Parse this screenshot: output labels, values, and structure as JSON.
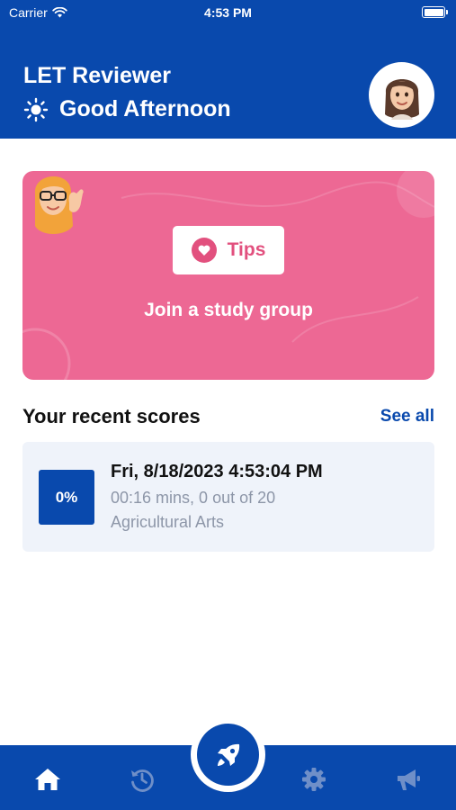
{
  "status_bar": {
    "carrier": "Carrier",
    "time": "4:53 PM"
  },
  "header": {
    "title": "LET Reviewer",
    "greeting": "Good Afternoon",
    "greeting_icon": "sun-icon"
  },
  "tips": {
    "label": "Tips",
    "message": "Join a study group",
    "icon": "heart-icon"
  },
  "recent_scores": {
    "title": "Your recent scores",
    "see_all": "See all",
    "items": [
      {
        "score": "0%",
        "date": "Fri, 8/18/2023 4:53:04 PM",
        "stats": "00:16 mins, 0 out of 20",
        "subject": "Agricultural Arts"
      }
    ]
  },
  "tabbar": {
    "items": [
      {
        "name": "home",
        "icon": "home-icon",
        "active": true
      },
      {
        "name": "history",
        "icon": "history-icon",
        "active": false
      },
      {
        "name": "settings",
        "icon": "gear-icon",
        "active": false
      },
      {
        "name": "announcements",
        "icon": "megaphone-icon",
        "active": false
      }
    ],
    "center_action": "rocket-icon"
  },
  "colors": {
    "primary": "#0949ad",
    "card": "#ed6894",
    "muted": "#8d96a8"
  }
}
